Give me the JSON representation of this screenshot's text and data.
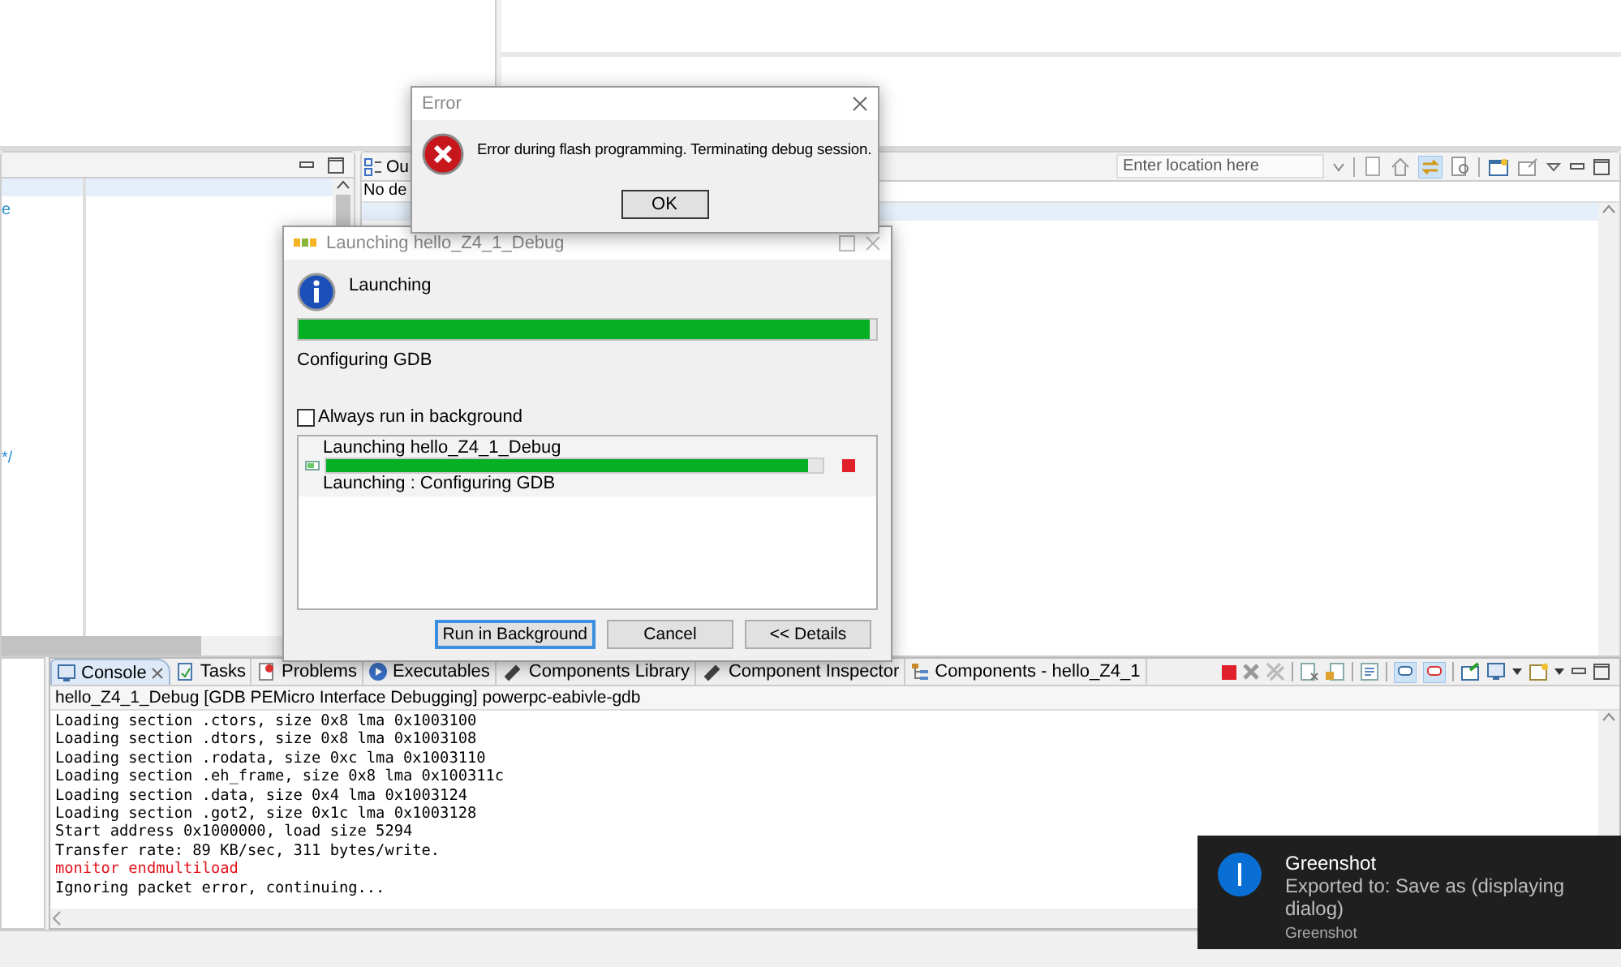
{
  "editor_panel": {
    "code_fragments": [
      "e",
      "*/"
    ]
  },
  "outline_panel": {
    "tab": "Ou",
    "message": "No de"
  },
  "browser_toolbar": {
    "location": {
      "placeholder": "Enter location here"
    }
  },
  "console": {
    "tabs": [
      {
        "label": "Console",
        "selected": true
      },
      {
        "label": "Tasks",
        "selected": false
      },
      {
        "label": "Problems",
        "selected": false
      },
      {
        "label": "Executables",
        "selected": false
      },
      {
        "label": "Components Library",
        "selected": false
      },
      {
        "label": "Component Inspector",
        "selected": false
      },
      {
        "label": "Components - hello_Z4_1",
        "selected": false
      }
    ],
    "session": "hello_Z4_1_Debug [GDB PEMicro Interface Debugging] powerpc-eabivle-gdb",
    "lines": [
      {
        "text": "Loading section .ctors, size 0x8 lma 0x1003100",
        "kind": "output"
      },
      {
        "text": "Loading section .dtors, size 0x8 lma 0x1003108",
        "kind": "output"
      },
      {
        "text": "Loading section .rodata, size 0xc lma 0x1003110",
        "kind": "output"
      },
      {
        "text": "Loading section .eh_frame, size 0x8 lma 0x100311c",
        "kind": "output"
      },
      {
        "text": "Loading section .data, size 0x4 lma 0x1003124",
        "kind": "output"
      },
      {
        "text": "Loading section .got2, size 0x1c lma 0x1003128",
        "kind": "output"
      },
      {
        "text": "Start address 0x1000000, load size 5294",
        "kind": "output"
      },
      {
        "text": "Transfer rate: 89 KB/sec, 311 bytes/write.",
        "kind": "output"
      },
      {
        "text": "monitor endmultiload",
        "kind": "command"
      },
      {
        "text": "Ignoring packet error, continuing...",
        "kind": "output"
      }
    ]
  },
  "error_dialog": {
    "title": "Error",
    "message": "Error during flash programming. Terminating debug session.",
    "button": "OK"
  },
  "launch_dialog": {
    "title": "Launching hello_Z4_1_Debug",
    "heading": "Launching",
    "level": 0.99,
    "status": "Configuring GDB",
    "always_run_in_background": {
      "label": "Always run in background",
      "checked": false
    },
    "job": {
      "name": "Launching hello_Z4_1_Debug",
      "level": 0.97,
      "status": "Launching : Configuring GDB"
    },
    "buttons": [
      {
        "label": "Run in Background",
        "default": true
      },
      {
        "label": "Cancel",
        "default": false
      },
      {
        "label": "<< Details",
        "default": false
      }
    ]
  },
  "notification": {
    "title": "Greenshot",
    "message": "Exported to: Save as (displaying dialog)",
    "source": "Greenshot"
  }
}
